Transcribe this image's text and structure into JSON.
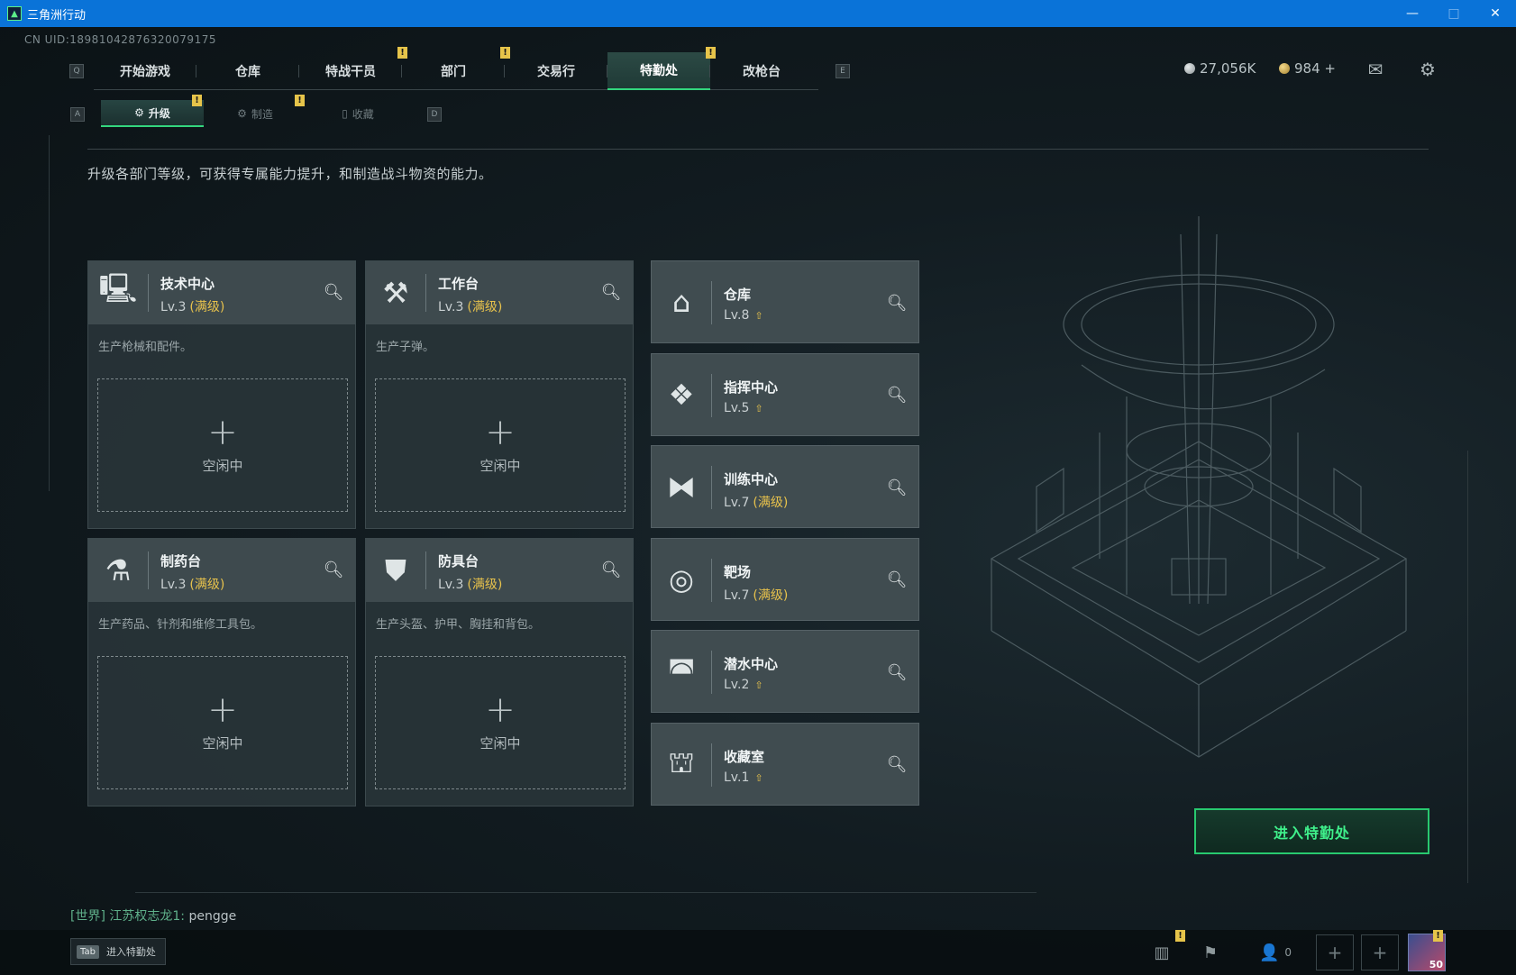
{
  "window": {
    "title": "三角洲行动",
    "minimize": "—",
    "maximize": "□",
    "close": "✕"
  },
  "uid": "CN UID:18981042876320079175",
  "nav": {
    "left_key": "Q",
    "right_key": "E",
    "items": [
      {
        "label": "开始游戏",
        "active": false,
        "alert": false
      },
      {
        "label": "仓库",
        "active": false,
        "alert": false
      },
      {
        "label": "特战干员",
        "active": false,
        "alert": true
      },
      {
        "label": "部门",
        "active": false,
        "alert": true
      },
      {
        "label": "交易行",
        "active": false,
        "alert": false
      },
      {
        "label": "特勤处",
        "active": true,
        "alert": true
      },
      {
        "label": "改枪台",
        "active": false,
        "alert": false
      }
    ]
  },
  "currency": {
    "coins": "27,056K",
    "tickets": "984 +"
  },
  "subnav": {
    "left_key": "A",
    "right_key": "D",
    "items": [
      {
        "label": "升级",
        "icon": "⚙",
        "active": true
      },
      {
        "label": "制造",
        "icon": "⚙",
        "active": false
      },
      {
        "label": "收藏",
        "icon": "▯",
        "active": false
      }
    ]
  },
  "alert_glyph": "!",
  "description": "升级各部门等级，可获得专属能力提升，和制造战斗物资的能力。",
  "left_cards": [
    {
      "title": "技术中心",
      "level": "Lv.3",
      "max": "(满级)",
      "desc": "生产枪械和配件。",
      "icon": "computer-icon"
    },
    {
      "title": "工作台",
      "level": "Lv.3",
      "max": "(满级)",
      "desc": "生产子弹。",
      "icon": "tools-icon"
    },
    {
      "title": "制药台",
      "level": "Lv.3",
      "max": "(满级)",
      "desc": "生产药品、针剂和维修工具包。",
      "icon": "microscope-icon"
    },
    {
      "title": "防具台",
      "level": "Lv.3",
      "max": "(满级)",
      "desc": "生产头盔、护甲、胸挂和背包。",
      "icon": "armor-icon"
    }
  ],
  "slot": {
    "plus": "+",
    "idle": "空闲中"
  },
  "right_cards": [
    {
      "title": "仓库",
      "level": "Lv.8",
      "max": "",
      "upgradable": true,
      "icon": "warehouse-icon"
    },
    {
      "title": "指挥中心",
      "level": "Lv.5",
      "max": "",
      "upgradable": true,
      "icon": "command-icon"
    },
    {
      "title": "训练中心",
      "level": "Lv.7",
      "max": "(满级)",
      "upgradable": false,
      "icon": "dumbbell-icon"
    },
    {
      "title": "靶场",
      "level": "Lv.7",
      "max": "(满级)",
      "upgradable": false,
      "icon": "target-icon"
    },
    {
      "title": "潜水中心",
      "level": "Lv.2",
      "max": "",
      "upgradable": true,
      "icon": "diving-mask-icon"
    },
    {
      "title": "收藏室",
      "level": "Lv.1",
      "max": "",
      "upgradable": true,
      "icon": "vault-icon"
    }
  ],
  "enter_button": "进入特勤处",
  "chat": {
    "channel": "[世界]",
    "user": "江苏权志龙1:",
    "message": "pengge"
  },
  "bottom": {
    "tab_key": "Tab",
    "tab_label": "进入特勤处",
    "friends_count": "0",
    "avatar_level": "50"
  },
  "colors": {
    "accent_green": "#33d67e",
    "alert_yellow": "#e6c44a",
    "max_gold": "#e7c24c",
    "titlebar_blue": "#0a73d8"
  }
}
